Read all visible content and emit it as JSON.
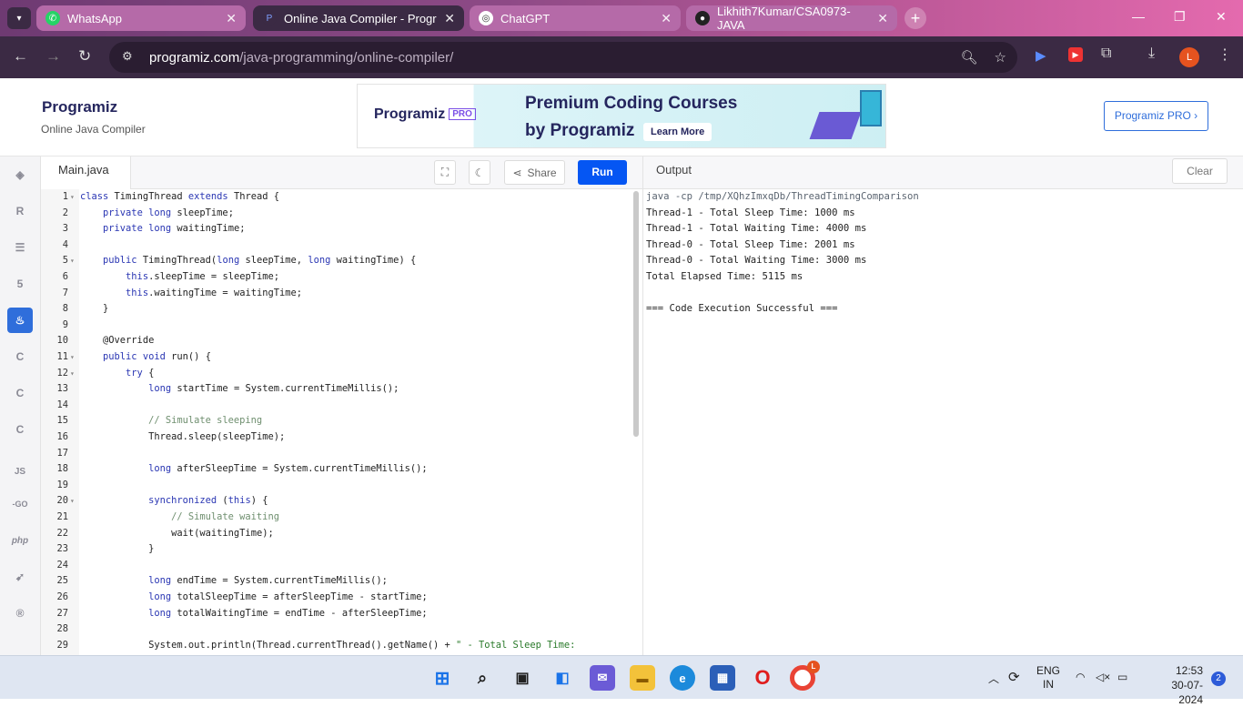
{
  "browser": {
    "tabs": [
      {
        "label": "WhatsApp",
        "icon": "whatsapp-icon",
        "active": false
      },
      {
        "label": "Online Java Compiler - Program",
        "icon": "programiz-icon",
        "active": true
      },
      {
        "label": "ChatGPT",
        "icon": "chatgpt-icon",
        "active": false
      },
      {
        "label": "Likhith7Kumar/CSA0973-JAVA",
        "icon": "github-icon",
        "active": false
      }
    ],
    "url_host": "programiz.com",
    "url_path": "/java-programming/online-compiler/",
    "profile_initial": "L"
  },
  "site": {
    "logo": "Programiz",
    "subtitle": "Online Java Compiler",
    "banner": {
      "logo": "Programiz",
      "pro": "PRO",
      "line1": "Premium Coding Courses",
      "line2": "by Programiz",
      "cta": "Learn More"
    },
    "pro_button": "Programiz PRO ›"
  },
  "rail": {
    "items": [
      "python-icon",
      "r-icon",
      "sql-icon",
      "html-icon",
      "java-icon",
      "c-icon",
      "cpp-icon",
      "csharp-icon",
      "js-icon",
      "go-icon",
      "php-icon",
      "swift-icon",
      "rust-icon"
    ],
    "js_label": "JS",
    "go_label": "-GO",
    "php_label": "php",
    "selected": "java-icon"
  },
  "editor": {
    "filename": "Main.java",
    "share_label": "Share",
    "run_label": "Run",
    "lines": [
      {
        "n": "1",
        "fold": true,
        "text": "class TimingThread extends Thread {"
      },
      {
        "n": "2",
        "fold": false,
        "text": "    private long sleepTime;"
      },
      {
        "n": "3",
        "fold": false,
        "text": "    private long waitingTime;"
      },
      {
        "n": "4",
        "fold": false,
        "text": ""
      },
      {
        "n": "5",
        "fold": true,
        "text": "    public TimingThread(long sleepTime, long waitingTime) {"
      },
      {
        "n": "6",
        "fold": false,
        "text": "        this.sleepTime = sleepTime;"
      },
      {
        "n": "7",
        "fold": false,
        "text": "        this.waitingTime = waitingTime;"
      },
      {
        "n": "8",
        "fold": false,
        "text": "    }"
      },
      {
        "n": "9",
        "fold": false,
        "text": ""
      },
      {
        "n": "10",
        "fold": false,
        "text": "    @Override"
      },
      {
        "n": "11",
        "fold": true,
        "text": "    public void run() {"
      },
      {
        "n": "12",
        "fold": true,
        "text": "        try {"
      },
      {
        "n": "13",
        "fold": false,
        "text": "            long startTime = System.currentTimeMillis();"
      },
      {
        "n": "14",
        "fold": false,
        "text": ""
      },
      {
        "n": "15",
        "fold": false,
        "text": "            // Simulate sleeping"
      },
      {
        "n": "16",
        "fold": false,
        "text": "            Thread.sleep(sleepTime);"
      },
      {
        "n": "17",
        "fold": false,
        "text": ""
      },
      {
        "n": "18",
        "fold": false,
        "text": "            long afterSleepTime = System.currentTimeMillis();"
      },
      {
        "n": "19",
        "fold": false,
        "text": ""
      },
      {
        "n": "20",
        "fold": true,
        "text": "            synchronized (this) {"
      },
      {
        "n": "21",
        "fold": false,
        "text": "                // Simulate waiting"
      },
      {
        "n": "22",
        "fold": false,
        "text": "                wait(waitingTime);"
      },
      {
        "n": "23",
        "fold": false,
        "text": "            }"
      },
      {
        "n": "24",
        "fold": false,
        "text": ""
      },
      {
        "n": "25",
        "fold": false,
        "text": "            long endTime = System.currentTimeMillis();"
      },
      {
        "n": "26",
        "fold": false,
        "text": "            long totalSleepTime = afterSleepTime - startTime;"
      },
      {
        "n": "27",
        "fold": false,
        "text": "            long totalWaitingTime = endTime - afterSleepTime;"
      },
      {
        "n": "28",
        "fold": false,
        "text": ""
      },
      {
        "n": "29",
        "fold": false,
        "text": "            System.out.println(Thread.currentThread().getName() + \" - Total Sleep Time:"
      }
    ]
  },
  "output": {
    "title": "Output",
    "clear_label": "Clear",
    "lines": [
      "java -cp /tmp/XQhzImxqDb/ThreadTimingComparison",
      "Thread-1 - Total Sleep Time: 1000 ms",
      "Thread-1 - Total Waiting Time: 4000 ms",
      "Thread-0 - Total Sleep Time: 2001 ms",
      "Thread-0 - Total Waiting Time: 3000 ms",
      "Total Elapsed Time: 5115 ms",
      "",
      "=== Code Execution Successful ==="
    ]
  },
  "taskbar": {
    "language": "ENG",
    "region": "IN",
    "time": "12:53",
    "date": "30-07-2024",
    "notifications": "2",
    "chrome_badge": "L"
  }
}
